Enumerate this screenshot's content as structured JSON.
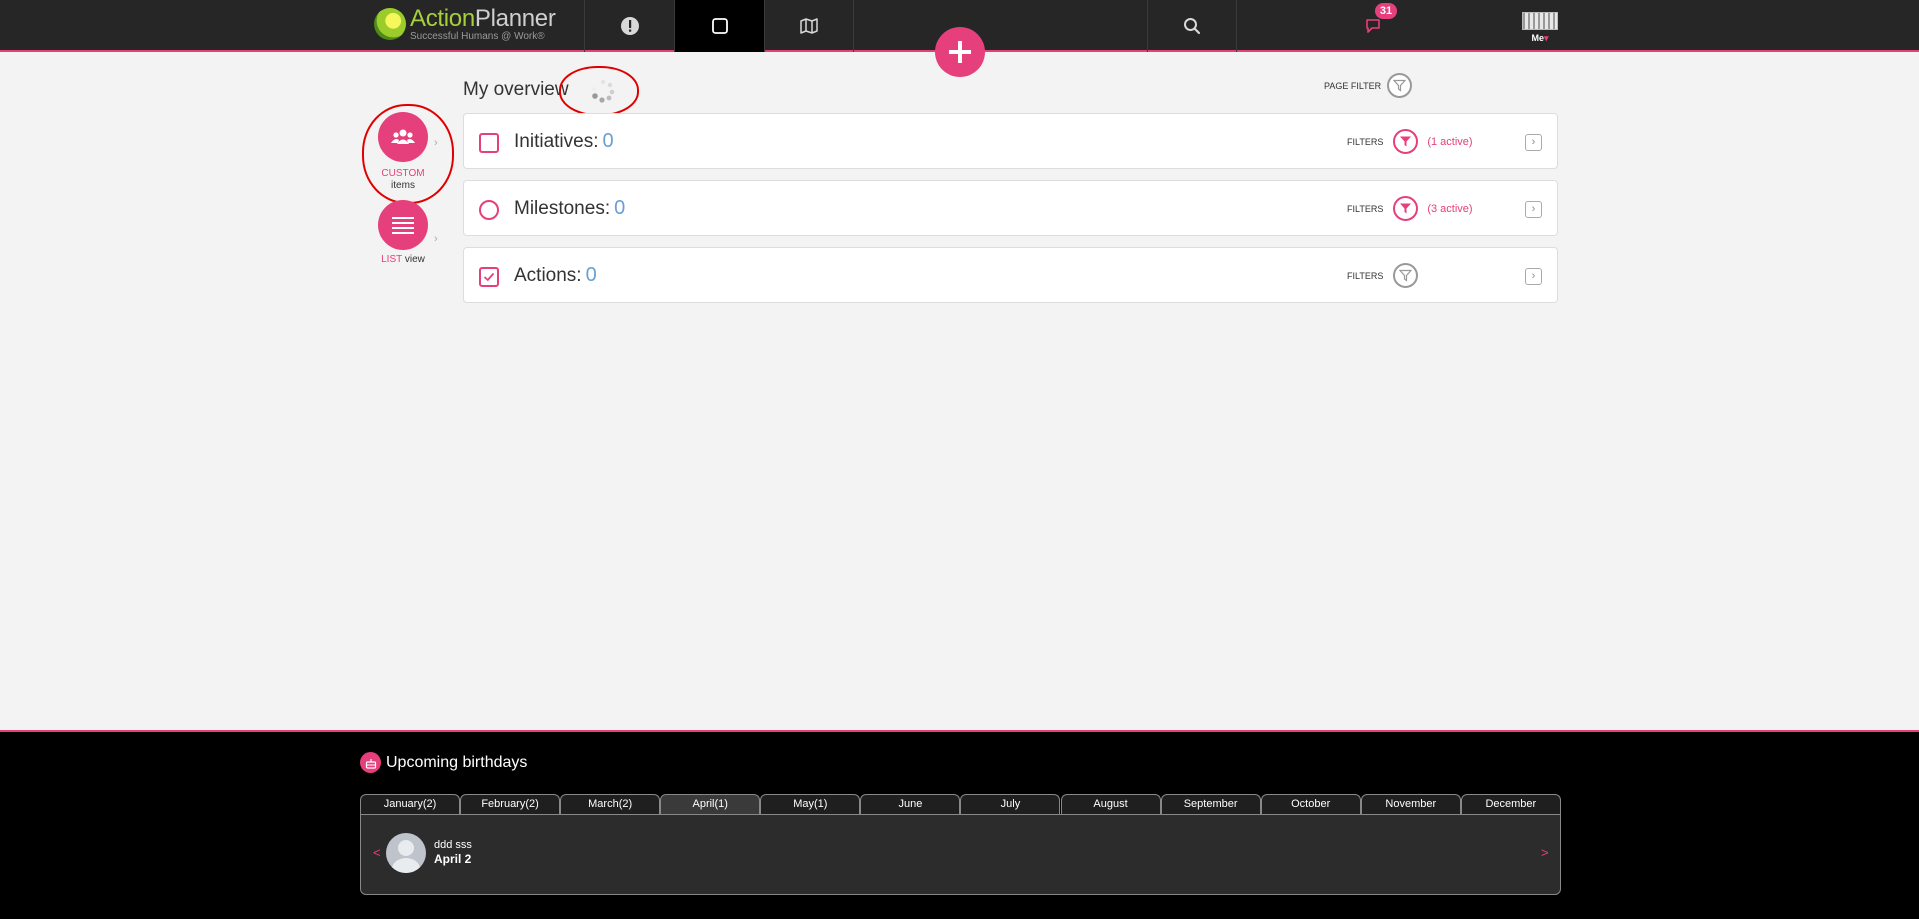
{
  "topbar": {
    "logo": {
      "name_part1": "Action",
      "name_part2": "Planner",
      "tagline": "Successful Humans @ Work®"
    },
    "nav": [
      {
        "name": "alert-icon"
      },
      {
        "name": "square-icon",
        "active": true
      },
      {
        "name": "map-icon"
      }
    ],
    "search_icon": "search-icon",
    "notifications": {
      "icon": "speech-bubble-icon",
      "count": "31"
    },
    "user": {
      "label": "Me",
      "caret": "▾"
    },
    "add_icon": "plus-icon"
  },
  "main": {
    "title": "My overview",
    "page_filter_label": "PAGE FILTER",
    "side": {
      "custom": {
        "label_accent": "CUSTOM",
        "label_rest": "items",
        "icon": "group-icon"
      },
      "list": {
        "label_accent": "LIST",
        "label_rest": "view",
        "icon": "list-icon"
      }
    },
    "cards": [
      {
        "title": "Initiatives:",
        "count": "0",
        "filters_label": "FILTERS",
        "active": "(1 active)",
        "icon": "checkbox-square-icon"
      },
      {
        "title": "Milestones:",
        "count": "0",
        "filters_label": "FILTERS",
        "active": "(3 active)",
        "icon": "circle-icon"
      },
      {
        "title": "Actions:",
        "count": "0",
        "filters_label": "FILTERS",
        "active": "",
        "icon": "checked-square-icon"
      }
    ],
    "arrow": "›"
  },
  "footer": {
    "title": "Upcoming birthdays",
    "months": [
      "January(2)",
      "February(2)",
      "March(2)",
      "April(1)",
      "May(1)",
      "June",
      "July",
      "August",
      "September",
      "October",
      "November",
      "December"
    ],
    "active_month": "April(1)",
    "person": {
      "name": "ddd sss",
      "date": "April 2"
    },
    "prev": "<",
    "next": ">"
  },
  "colors": {
    "accent": "#e5407b",
    "topbar": "#262626",
    "count": "#6a9fd4",
    "annotation": "#e00000"
  }
}
